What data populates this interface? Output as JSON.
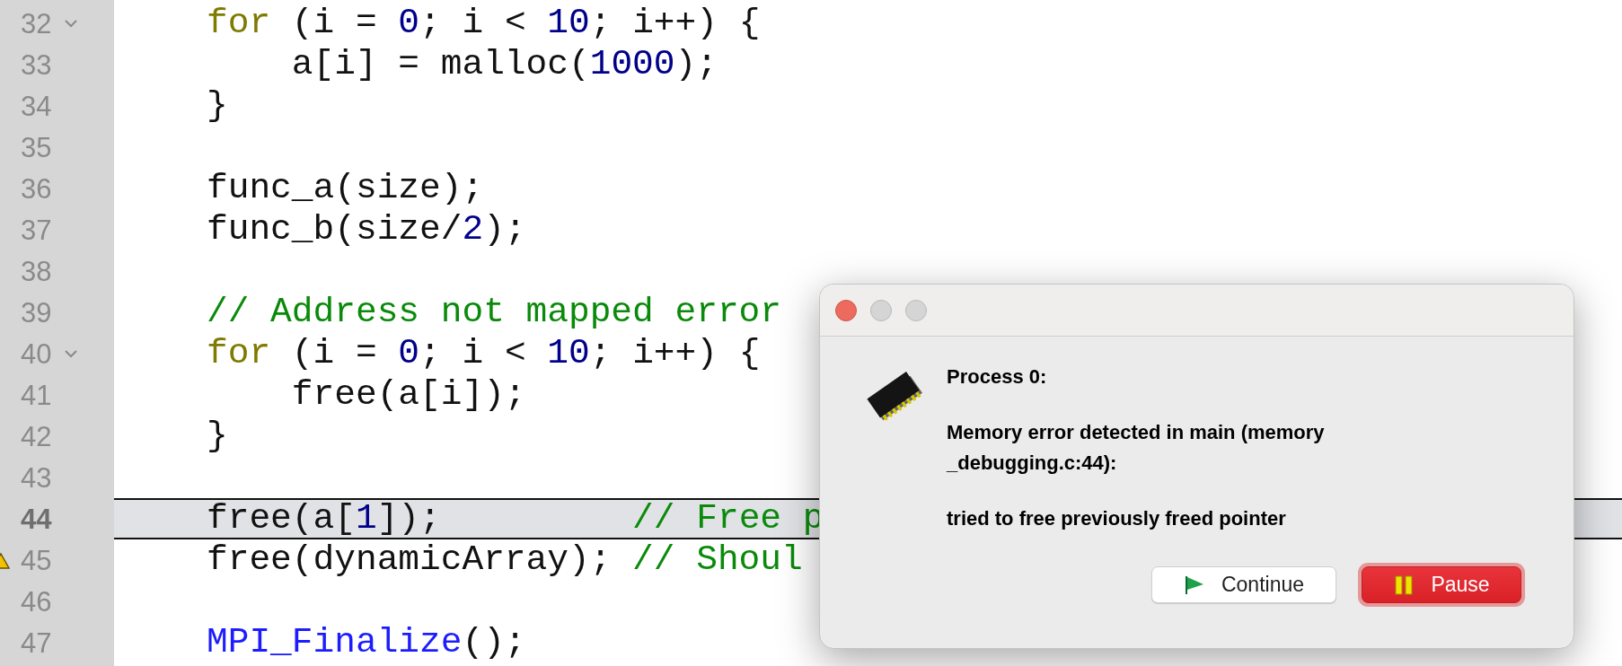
{
  "editor": {
    "lines": [
      {
        "number": "32",
        "foldable": true,
        "current": false,
        "warning": false,
        "tokens": [
          {
            "kind": "keyword",
            "text": "for"
          },
          {
            "kind": "plain",
            "text": " (i = "
          },
          {
            "kind": "number",
            "text": "0"
          },
          {
            "kind": "plain",
            "text": "; i < "
          },
          {
            "kind": "number",
            "text": "10"
          },
          {
            "kind": "plain",
            "text": "; i++) {"
          }
        ]
      },
      {
        "number": "33",
        "foldable": false,
        "current": false,
        "warning": false,
        "tokens": [
          {
            "kind": "plain",
            "text": "    a[i] = malloc("
          },
          {
            "kind": "number",
            "text": "1000"
          },
          {
            "kind": "plain",
            "text": ");"
          }
        ]
      },
      {
        "number": "34",
        "foldable": false,
        "current": false,
        "warning": false,
        "tokens": [
          {
            "kind": "plain",
            "text": "}"
          }
        ]
      },
      {
        "number": "35",
        "foldable": false,
        "current": false,
        "warning": false
      },
      {
        "number": "36",
        "foldable": false,
        "current": false,
        "warning": false,
        "tokens": [
          {
            "kind": "plain",
            "text": "func_a(size);"
          }
        ]
      },
      {
        "number": "37",
        "foldable": false,
        "current": false,
        "warning": false,
        "tokens": [
          {
            "kind": "plain",
            "text": "func_b(size/"
          },
          {
            "kind": "number",
            "text": "2"
          },
          {
            "kind": "plain",
            "text": ");"
          }
        ]
      },
      {
        "number": "38",
        "foldable": false,
        "current": false,
        "warning": false
      },
      {
        "number": "39",
        "foldable": false,
        "current": false,
        "warning": false,
        "tokens": [
          {
            "kind": "comment",
            "text": "// Address not mapped error"
          }
        ]
      },
      {
        "number": "40",
        "foldable": true,
        "current": false,
        "warning": false,
        "tokens": [
          {
            "kind": "keyword",
            "text": "for"
          },
          {
            "kind": "plain",
            "text": " (i = "
          },
          {
            "kind": "number",
            "text": "0"
          },
          {
            "kind": "plain",
            "text": "; i < "
          },
          {
            "kind": "number",
            "text": "10"
          },
          {
            "kind": "plain",
            "text": "; i++) {"
          }
        ]
      },
      {
        "number": "41",
        "foldable": false,
        "current": false,
        "warning": false,
        "tokens": [
          {
            "kind": "plain",
            "text": "    free(a[i]);"
          }
        ]
      },
      {
        "number": "42",
        "foldable": false,
        "current": false,
        "warning": false,
        "tokens": [
          {
            "kind": "plain",
            "text": "}"
          }
        ]
      },
      {
        "number": "43",
        "foldable": false,
        "current": false,
        "warning": false
      },
      {
        "number": "44",
        "foldable": false,
        "current": true,
        "warning": false,
        "tokens": [
          {
            "kind": "plain",
            "text": "free(a["
          },
          {
            "kind": "number",
            "text": "1"
          },
          {
            "kind": "plain",
            "text": "]);         "
          },
          {
            "kind": "comment",
            "text": "// Free p"
          }
        ]
      },
      {
        "number": "45",
        "foldable": false,
        "current": false,
        "warning": true,
        "tokens": [
          {
            "kind": "plain",
            "text": "free(dynamicArray); "
          },
          {
            "kind": "comment",
            "text": "// Shoul"
          }
        ]
      },
      {
        "number": "46",
        "foldable": false,
        "current": false,
        "warning": false
      },
      {
        "number": "47",
        "foldable": false,
        "current": false,
        "warning": false,
        "tokens": [
          {
            "kind": "function",
            "text": "MPI_Finalize"
          },
          {
            "kind": "plain",
            "text": "();"
          }
        ]
      }
    ]
  },
  "dialog": {
    "title_buttons": [
      {
        "kind": "close",
        "disabled": false
      },
      {
        "kind": "minimize",
        "disabled": true
      },
      {
        "kind": "zoom",
        "disabled": true
      }
    ],
    "heading": "Process 0:",
    "message_lines": [
      "Memory error detected in main (memory",
      "_debugging.c:44):"
    ],
    "detail": "tried to free previously freed pointer",
    "buttons": [
      {
        "kind": "continue",
        "label": "Continue",
        "default": false
      },
      {
        "kind": "pause",
        "label": "Pause",
        "default": true
      }
    ]
  }
}
